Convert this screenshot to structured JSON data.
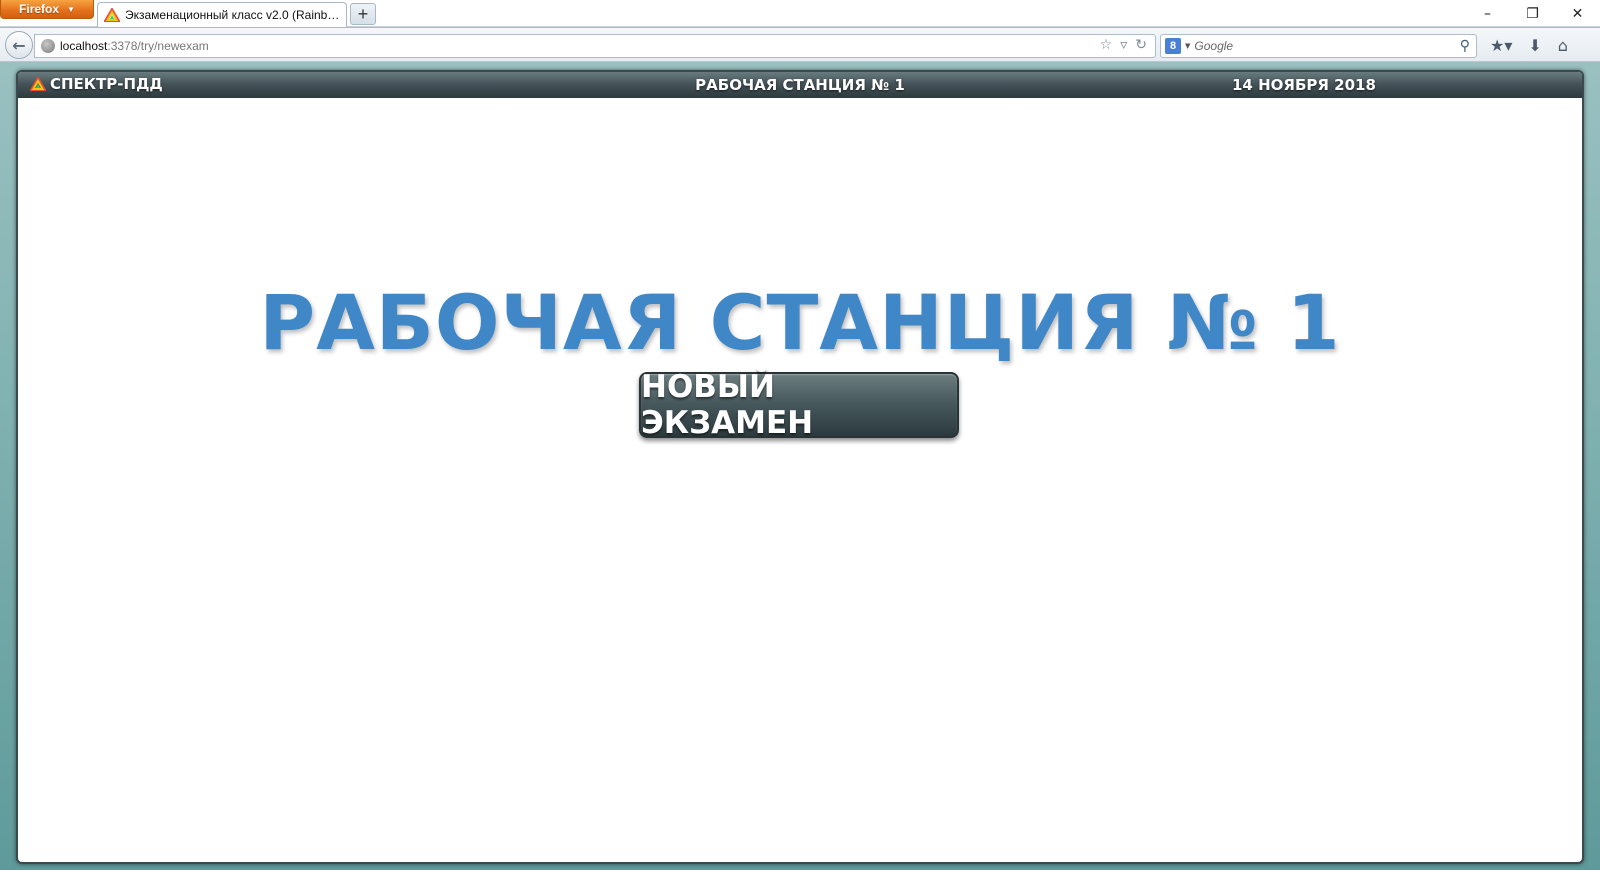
{
  "browser": {
    "menu_label": "Firefox",
    "tab_title": "Экзаменационный класс v2.0 (Rainbow...",
    "new_tab_label": "+",
    "url_host": "localhost",
    "url_rest": ":3378/try/newexam",
    "search_engine_letter": "8",
    "search_placeholder": "Google",
    "window_controls": {
      "minimize": "–",
      "restore": "❐",
      "close": "✕"
    }
  },
  "app": {
    "brand": "СПЕКТР-ПДД",
    "header_station": "РАБОЧАЯ СТАНЦИЯ № 1",
    "date": "14 НОЯБРЯ 2018",
    "main_title": "РАБОЧАЯ СТАНЦИЯ № 1",
    "new_exam_button": "НОВЫЙ ЭКЗАМЕН"
  },
  "colors": {
    "title_blue": "#3f87c7",
    "header_dark": "#2d393d",
    "firefox_orange": "#e36f1b"
  }
}
